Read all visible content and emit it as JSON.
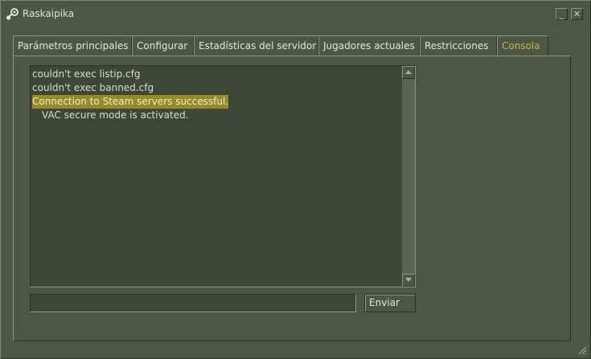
{
  "window": {
    "title": "Raskaipika",
    "minimize_label": "_",
    "close_label": "✕",
    "app_icon": "steam-logo-icon"
  },
  "tabs": [
    {
      "label": "Parámetros principales",
      "active": false
    },
    {
      "label": "Configurar",
      "active": false
    },
    {
      "label": "Estadísticas del servidor",
      "active": false
    },
    {
      "label": "Jugadores actuales",
      "active": false
    },
    {
      "label": "Restricciones",
      "active": false
    },
    {
      "label": "Consola",
      "active": true
    }
  ],
  "console": {
    "lines": [
      {
        "text": "couldn't exec listip.cfg",
        "highlight": false
      },
      {
        "text": "couldn't exec banned.cfg",
        "highlight": false
      },
      {
        "text": "Connection to Steam servers successful.",
        "highlight": true
      },
      {
        "text": "VAC secure mode is activated.",
        "highlight": false
      }
    ],
    "input_value": "",
    "send_label": "Enviar"
  },
  "colors": {
    "background": "#4c5844",
    "active_tab_text": "#c4b550",
    "highlight": "#968b26"
  }
}
